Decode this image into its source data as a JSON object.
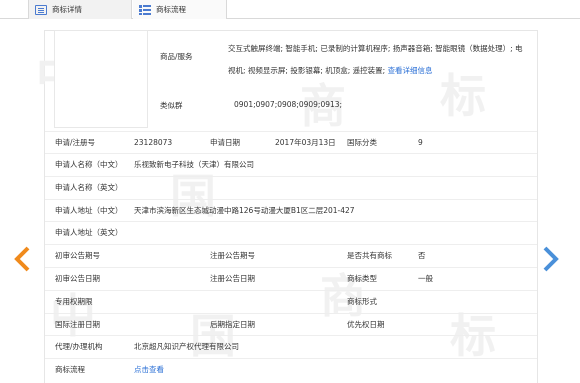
{
  "tabs": [
    {
      "label": "商标详情",
      "icon": "document-icon",
      "active": true
    },
    {
      "label": "商标流程",
      "icon": "flowchart-icon",
      "active": false
    }
  ],
  "watermark": [
    "中",
    "国",
    "商",
    "标"
  ],
  "goods": {
    "label": "商品/服务",
    "text": "交互式触屏终端; 智能手机; 已录制的计算机程序; 扬声器音箱; 智能眼镜（数据处理）; 电视机; 视频显示屏; 投影银幕; 机顶盒; 遥控装置;",
    "more_link": "查看详细信息"
  },
  "similar_group": {
    "label": "类似群",
    "value": "0901;0907;0908;0909;0913;"
  },
  "fields": {
    "reg_no_label": "申请/注册号",
    "reg_no": "23128073",
    "app_date_label": "申请日期",
    "app_date": "2017年03月13日",
    "class_label": "国际分类",
    "class_value": "9",
    "applicant_cn_label": "申请人名称（中文）",
    "applicant_cn": "乐视致新电子科技（天津）有限公司",
    "applicant_en_label": "申请人名称（英文）",
    "address_cn_label": "申请人地址（中文）",
    "address_cn": "天津市滨海新区生态城动漫中路126号动漫大厦B1区二层201-427",
    "address_en_label": "申请人地址（英文）",
    "prelim_no_label": "初审公告期号",
    "reg_pub_no_label": "注册公告期号",
    "shared_label": "是否共有商标",
    "shared_value": "否",
    "prelim_date_label": "初审公告日期",
    "reg_pub_date_label": "注册公告日期",
    "type_label": "商标类型",
    "type_value": "一般",
    "exclusive_label": "专用权期限",
    "form_label": "商标形式",
    "intl_date_label": "国际注册日期",
    "later_date_label": "后期指定日期",
    "priority_label": "优先权日期",
    "agent_label": "代理/办理机构",
    "agent_value": "北京超凡知识产权代理有限公司",
    "process_label": "商标流程",
    "process_link": "点击查看"
  },
  "colors": {
    "link": "#2a6fd6",
    "arrow_left": "#f08a1c",
    "arrow_right": "#4a90d9",
    "tab_icon": "#4b7bd0"
  },
  "nav": {
    "prev_icon": "chevron-left-icon",
    "next_icon": "chevron-right-icon"
  }
}
